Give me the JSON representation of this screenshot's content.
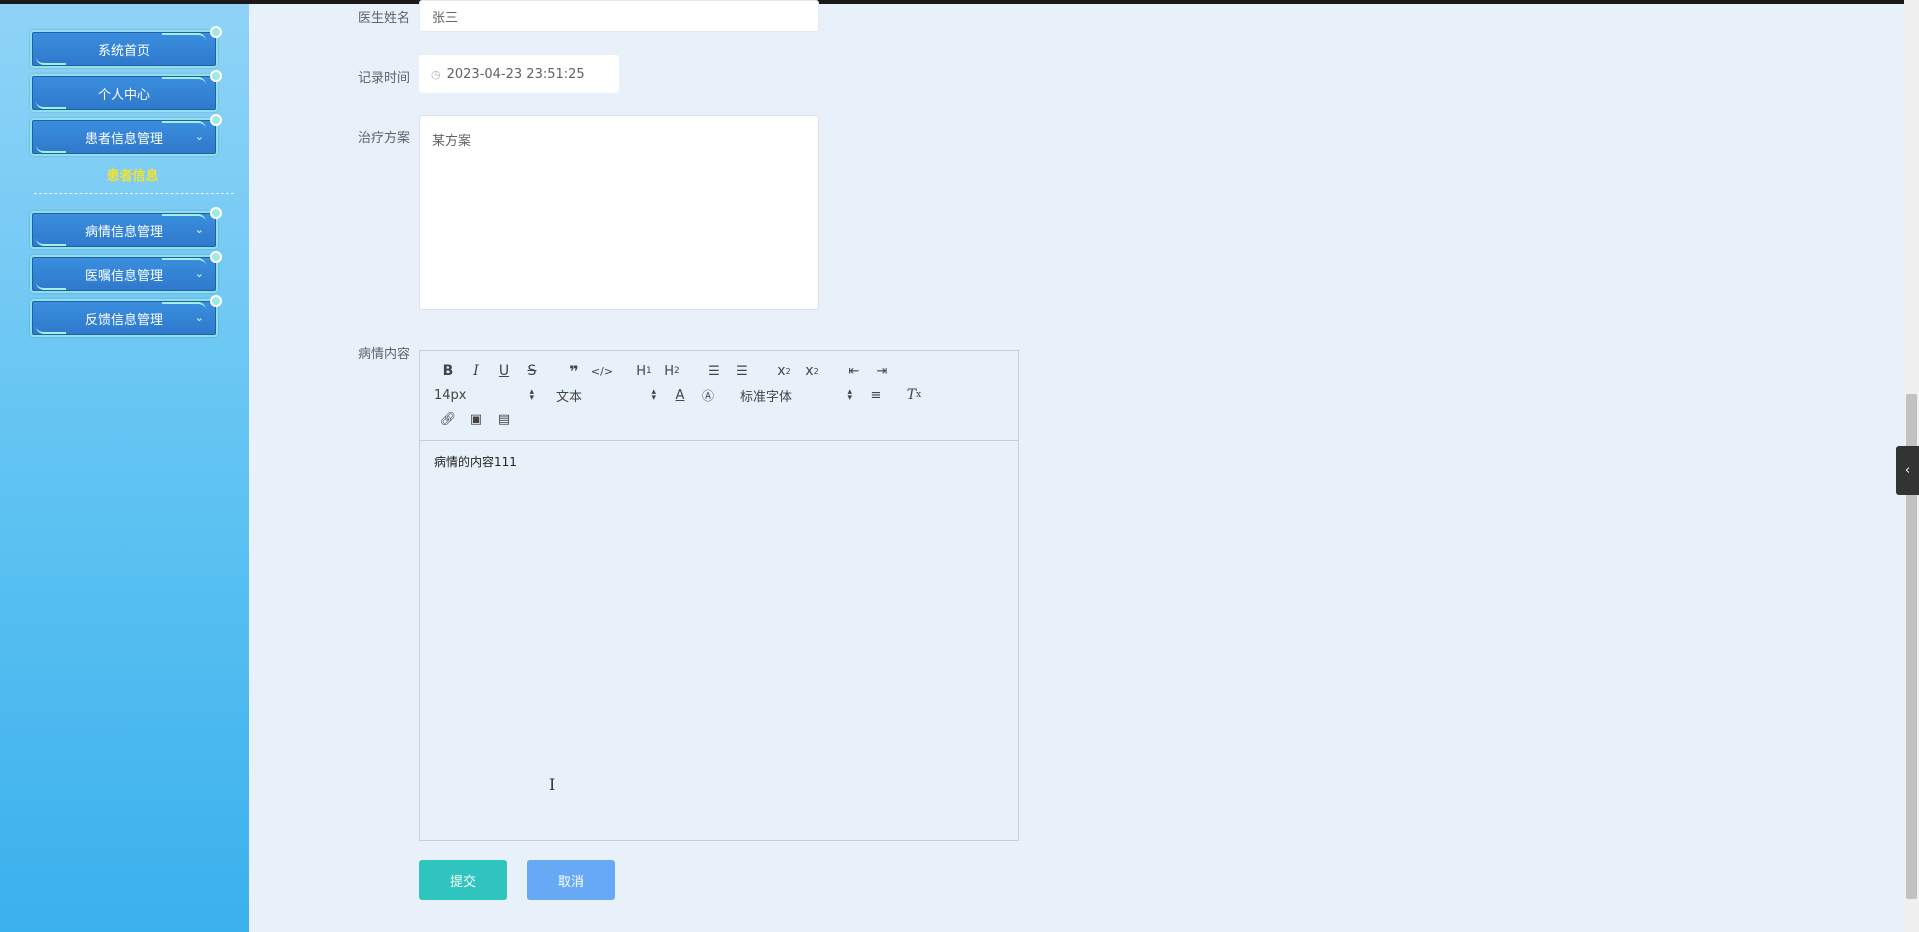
{
  "sidebar": {
    "items": [
      {
        "label": "系统首页"
      },
      {
        "label": "个人中心"
      },
      {
        "label": "患者信息管理"
      },
      {
        "label": "病情信息管理"
      },
      {
        "label": "医嘱信息管理"
      },
      {
        "label": "反馈信息管理"
      }
    ],
    "submenu_label": "患者信息"
  },
  "form": {
    "doctor_name": {
      "label": "医生姓名",
      "value": "张三"
    },
    "record_time": {
      "label": "记录时间",
      "value": "2023-04-23 23:51:25"
    },
    "treatment_plan": {
      "label": "治疗方案",
      "value": "某方案"
    },
    "condition_content": {
      "label": "病情内容",
      "value": "病情的内容111"
    }
  },
  "editor_toolbar": {
    "font_size": "14px",
    "header_type": "文本",
    "font_family": "标准字体"
  },
  "actions": {
    "submit_label": "提交",
    "cancel_label": "取消"
  },
  "colors": {
    "submit": "#2fc4bd",
    "cancel": "#68a9f6",
    "submenu_active": "#f2e233",
    "page_bg": "#e8f0fa"
  }
}
